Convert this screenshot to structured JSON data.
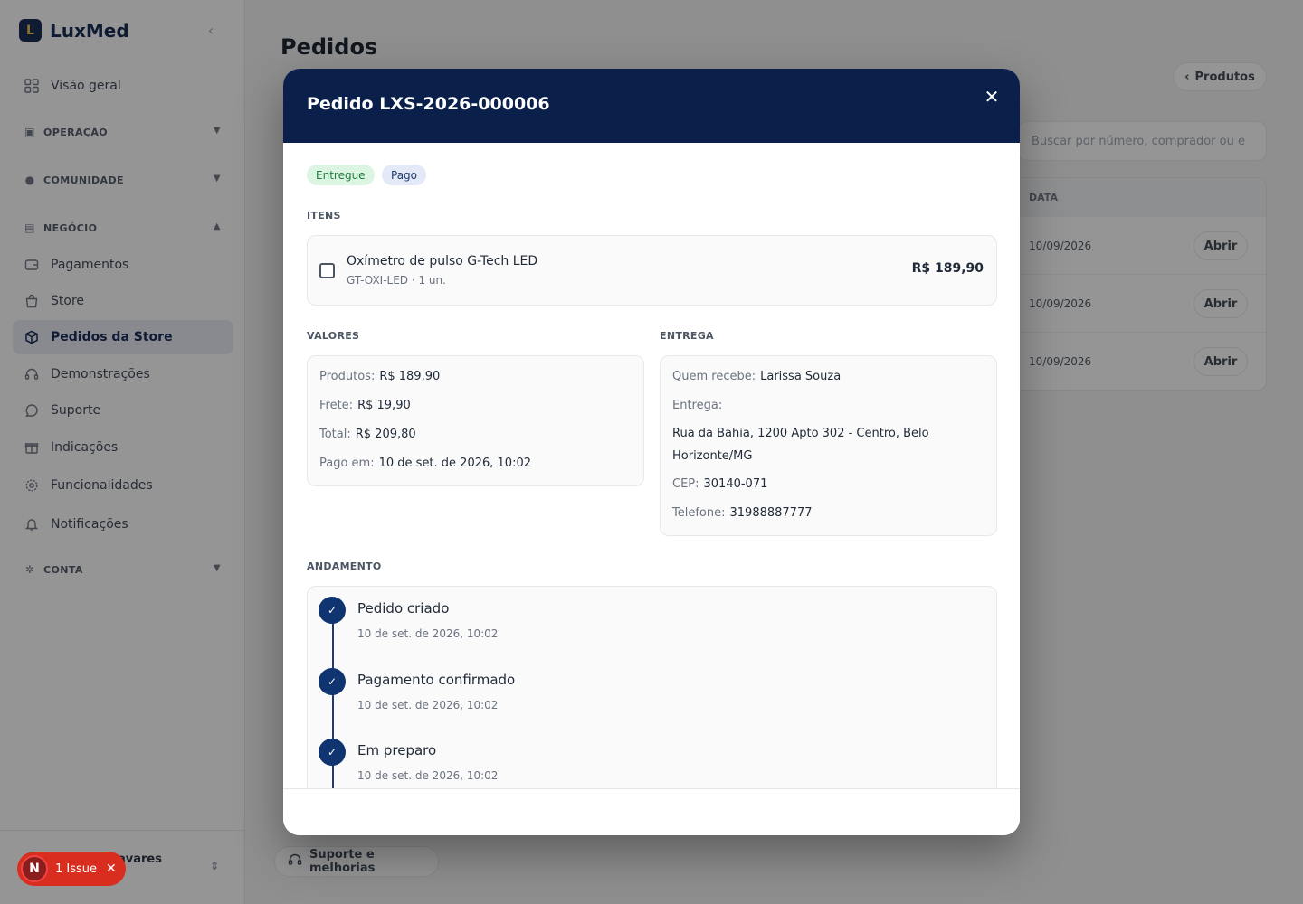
{
  "sidebar": {
    "brand_mark": "L",
    "brand": "LuxMed",
    "items": {
      "overview": "Visão geral",
      "payments": "Pagamentos",
      "store": "Store",
      "store_orders": "Pedidos da Store",
      "demos": "Demonstrações",
      "support": "Suporte",
      "referrals": "Indicações",
      "features": "Funcionalidades",
      "notifications": "Notificações"
    },
    "sections": {
      "operation": "OPERAÇÃO",
      "community": "COMUNIDADE",
      "business": "NEGÓCIO",
      "account": "CONTA"
    },
    "user_name_fragment": "avares"
  },
  "main": {
    "title": "Pedidos",
    "products_button": "Produtos",
    "search_placeholder": "Buscar por número, comprador ou e",
    "table": {
      "column_date": "DATA",
      "rows": [
        {
          "date": "10/09/2026",
          "action": "Abrir"
        },
        {
          "date": "10/09/2026",
          "action": "Abrir"
        },
        {
          "date": "10/09/2026",
          "action": "Abrir"
        }
      ]
    },
    "support_button": "Suporte e melhorias"
  },
  "issue_badge": {
    "letter": "N",
    "label": "1 Issue"
  },
  "modal": {
    "title": "Pedido LXS-2026-000006",
    "badges": {
      "delivery_status": "Entregue",
      "payment_status": "Pago"
    },
    "items_label": "ITENS",
    "item": {
      "name": "Oxímetro de pulso G-Tech LED",
      "meta": "GT-OXI-LED · 1 un.",
      "price": "R$ 189,90"
    },
    "values": {
      "label": "VALORES",
      "products_label": "Produtos:",
      "products_value": "R$ 189,90",
      "shipping_label": "Frete:",
      "shipping_value": "R$ 19,90",
      "total_label": "Total:",
      "total_value": "R$ 209,80",
      "paid_at_label": "Pago em:",
      "paid_at_value": "10 de set. de 2026, 10:02"
    },
    "delivery": {
      "label": "ENTREGA",
      "recipient_label": "Quem recebe:",
      "recipient_value": "Larissa Souza",
      "delivery_label": "Entrega:",
      "address": "Rua da Bahia, 1200 Apto 302 - Centro, Belo Horizonte/MG",
      "zip_label": "CEP:",
      "zip_value": "30140-071",
      "phone_label": "Telefone:",
      "phone_value": "31988887777"
    },
    "progress": {
      "label": "ANDAMENTO",
      "steps": [
        {
          "title": "Pedido criado",
          "date": "10 de set. de 2026, 10:02"
        },
        {
          "title": "Pagamento confirmado",
          "date": "10 de set. de 2026, 10:02"
        },
        {
          "title": "Em preparo",
          "date": "10 de set. de 2026, 10:02"
        }
      ]
    }
  },
  "colors": {
    "navy": "#0a1f4a",
    "accent_blue": "#0f3470",
    "delivered_bg": "#dcf5e3",
    "paid_bg": "#e3e9f6",
    "issue_red": "#d92d20"
  }
}
